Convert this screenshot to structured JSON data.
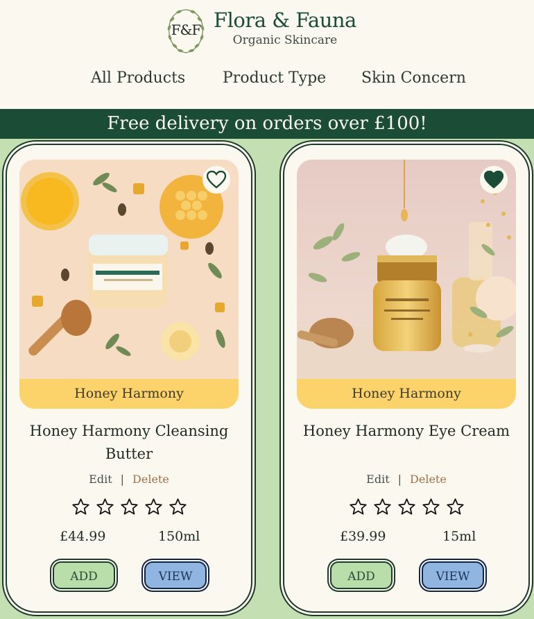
{
  "header": {
    "logo_monogram": "F&F",
    "brand_name": "Flora & Fauna",
    "tagline": "Organic Skincare"
  },
  "nav": {
    "items": [
      {
        "label": "All Products"
      },
      {
        "label": "Product Type"
      },
      {
        "label": "Skin Concern"
      }
    ]
  },
  "banner": {
    "text": "Free delivery on orders over £100!"
  },
  "products": [
    {
      "collection": "Honey Harmony",
      "name": "Honey Harmony Cleansing Butter",
      "edit_label": "Edit",
      "separator": "|",
      "delete_label": "Delete",
      "rating": 0,
      "rating_max": 5,
      "price": "£44.99",
      "size": "150ml",
      "add_label": "ADD",
      "view_label": "VIEW",
      "favourite": false,
      "image_alt": "Cleansing Butter jar with honeycomb and bees"
    },
    {
      "collection": "Honey Harmony",
      "name": "Honey Harmony Eye Cream",
      "edit_label": "Edit",
      "separator": "|",
      "delete_label": "Delete",
      "rating": 0,
      "rating_max": 5,
      "price": "£39.99",
      "size": "15ml",
      "add_label": "ADD",
      "view_label": "VIEW",
      "favourite": true,
      "image_alt": "Gold eye cream jar with honey dipper"
    }
  ],
  "colors": {
    "brand_green": "#1b4d36",
    "page_bg": "#fbf8ef",
    "content_bg": "#c4e0b3",
    "collection_yellow": "#fcd36b",
    "add_button": "#b9deaa",
    "view_button": "#8fb5e0",
    "delete_link": "#a0714a"
  },
  "icons": {
    "favourite": "heart-icon",
    "rating": "star-icon"
  }
}
